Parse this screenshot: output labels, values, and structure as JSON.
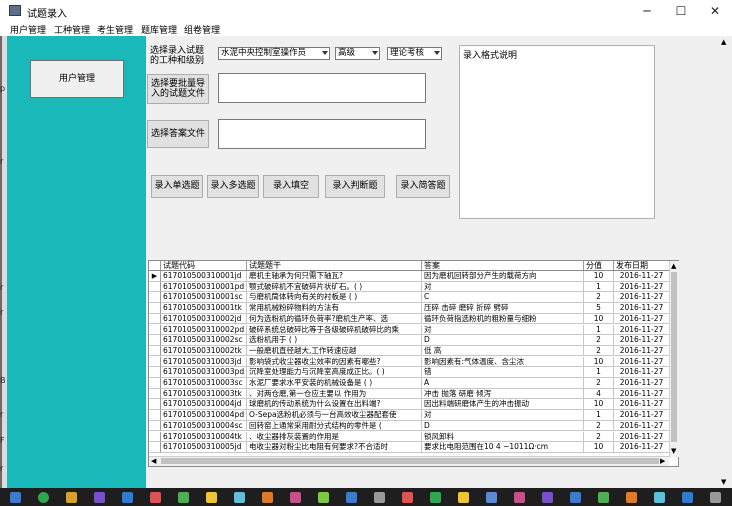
{
  "window": {
    "title": "试题录入",
    "minimize_glyph": "─",
    "maximize_glyph": "☐",
    "close_glyph": "✕"
  },
  "menu": [
    {
      "label": "用户管理"
    },
    {
      "label": "工种管理"
    },
    {
      "label": "考生管理"
    },
    {
      "label": "题库管理"
    },
    {
      "label": "组卷管理"
    }
  ],
  "sidebar": {
    "user_mgmt_button": "用户管理",
    "cut_letters": [
      "p",
      "r",
      "r",
      "r",
      "B",
      "r",
      "F",
      "r"
    ]
  },
  "form": {
    "select_label": "选择录入试题的工种和级别",
    "job_select": "水泥中央控制室操作员",
    "level_select": "高级",
    "type_select": "理论考核",
    "batch_label": "选择要批量导入的试题文件",
    "answer_label": "选择答案文件",
    "format_title": "录入格式说明"
  },
  "buttons": {
    "single": "录入单选题",
    "multi": "录入多选题",
    "fill": "录入填空",
    "judge": "录入判断题",
    "essay": "录入简答题"
  },
  "grid": {
    "columns": [
      "试题代码",
      "试题题干",
      "答案",
      "分值",
      "发布日期"
    ],
    "rows": [
      [
        "617010500310001jd",
        "磨机主轴承为何只需下轴瓦?",
        "因为磨机回转部分产生的载荷方向",
        "10",
        "2016-11-27"
      ],
      [
        "617010500310001pd",
        "颚式破碎机不宜破碎片状矿石。( )",
        "对",
        "1",
        "2016-11-27"
      ],
      [
        "617010500310001sc",
        "与磨机筒体转向有关的衬板是 ( )",
        "C",
        "2",
        "2016-11-27"
      ],
      [
        "617010500310001tk",
        "常用机械粉碎物料的方法有",
        "压碎 击碎 磨碎 折碎 劈碎",
        "5",
        "2016-11-27"
      ],
      [
        "617010500310002jd",
        "何为选粉机的循环负荷率?磨机生产率、选",
        "循环负荷指选粉机的粗粉量与细粉",
        "10",
        "2016-11-27"
      ],
      [
        "617010500310002pd",
        "破碎系统总破碎比等于各级破碎机破碎比的乘",
        "对",
        "1",
        "2016-11-27"
      ],
      [
        "617010500310002sc",
        "选粉机用于 ( )",
        "D",
        "2",
        "2016-11-27"
      ],
      [
        "617010500310002tk",
        "一般磨机直径越大,工作转速应越",
        "低 高",
        "2",
        "2016-11-27"
      ],
      [
        "617010500310003jd",
        "影响袋式收尘器收尘效率的因素有哪些?",
        "影响因素有:气体温度、含尘浓",
        "10",
        "2016-11-27"
      ],
      [
        "617010500310003pd",
        "沉降室处理能力与沉降室高度成正比。( )",
        "错",
        "1",
        "2016-11-27"
      ],
      [
        "617010500310003sc",
        "水泥厂要求水平安装的机械设备是 ( )",
        "A",
        "2",
        "2016-11-27"
      ],
      [
        "617010500310003tk",
        "、对两仓磨,第一仓应主要以 作用为",
        "冲击 抛落 研磨 倾泻",
        "4",
        "2016-11-27"
      ],
      [
        "617010500310004jd",
        "球磨机的传动系统为什么设置在出料端?",
        "因出料端研磨体产生的冲击振动",
        "10",
        "2016-11-27"
      ],
      [
        "617010500310004pd",
        "O-Sepa选粉机必须与一台高效收尘器配套使",
        "对",
        "1",
        "2016-11-27"
      ],
      [
        "617010500310004sc",
        "回转窑上通常采用耐分式结构的零件是 (",
        "D",
        "2",
        "2016-11-27"
      ],
      [
        "617010500310004tk",
        "、收尘器排灰装置的作用是",
        "锁风卸料",
        "2",
        "2016-11-27"
      ],
      [
        "617010500310005jd",
        "电收尘器对粉尘比电阻有何要求?不合适时",
        "要求比电阻范围在10 4 ~1011Ω·cm",
        "10",
        "2016-11-27"
      ]
    ],
    "current_row_marker": "▶"
  },
  "colors": {
    "sidebar_teal": "#19b9b9",
    "taskbar": "#1e1e1e"
  }
}
